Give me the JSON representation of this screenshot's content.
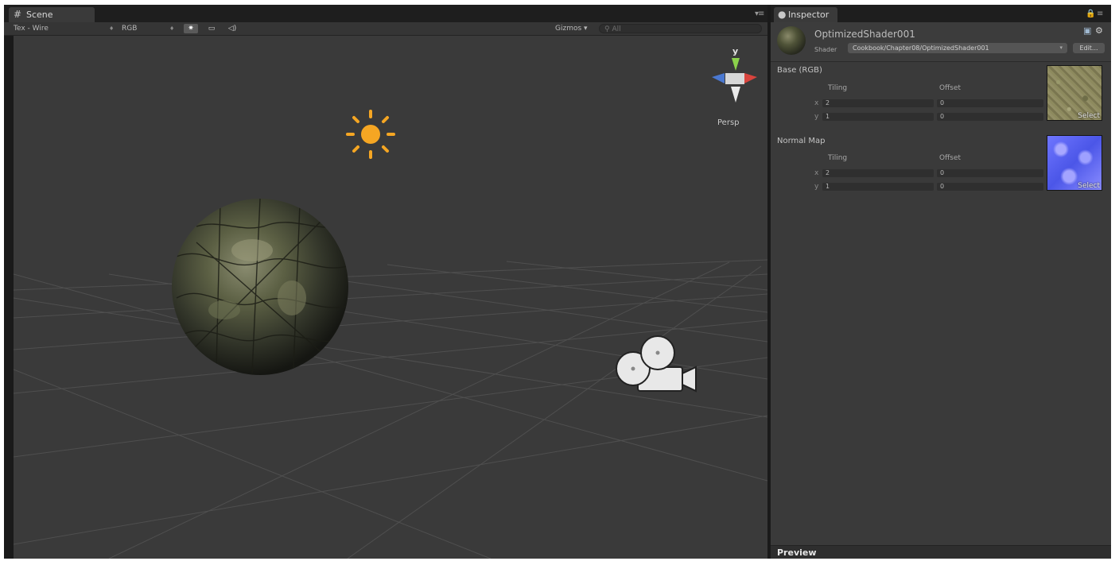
{
  "scene": {
    "tab_label": "Scene",
    "tab_icon": "grid-icon",
    "draw_mode": "Tex - Wire",
    "channel": "RGB",
    "gizmos_label": "Gizmos",
    "search_placeholder": "All",
    "view_label": "Persp",
    "axis_y_label": "y",
    "toggles": {
      "lighting": "sun-icon",
      "skybox": "image-icon",
      "audio": "audio-icon"
    }
  },
  "inspector": {
    "tab_label": "Inspector",
    "tab_icon": "info-icon",
    "material_name": "OptimizedShader001",
    "shader_label": "Shader",
    "shader_value": "Cookbook/Chapter08/OptimizedShader001",
    "edit_label": "Edit...",
    "textures": [
      {
        "title": "Base (RGB)",
        "tiling_label": "Tiling",
        "offset_label": "Offset",
        "x_label": "x",
        "y_label": "y",
        "tiling_x": "2",
        "tiling_y": "1",
        "offset_x": "0",
        "offset_y": "0",
        "select_label": "Select"
      },
      {
        "title": "Normal Map",
        "tiling_label": "Tiling",
        "offset_label": "Offset",
        "x_label": "x",
        "y_label": "y",
        "tiling_x": "2",
        "tiling_y": "1",
        "offset_x": "0",
        "offset_y": "0",
        "select_label": "Select"
      }
    ],
    "preview_label": "Preview"
  },
  "colors": {
    "panel_bg": "#3a3a3a",
    "light_icon": "#f5a623",
    "gizmo_y": "#8bd14b",
    "gizmo_x": "#d9443d",
    "gizmo_z": "#4a78d1"
  }
}
